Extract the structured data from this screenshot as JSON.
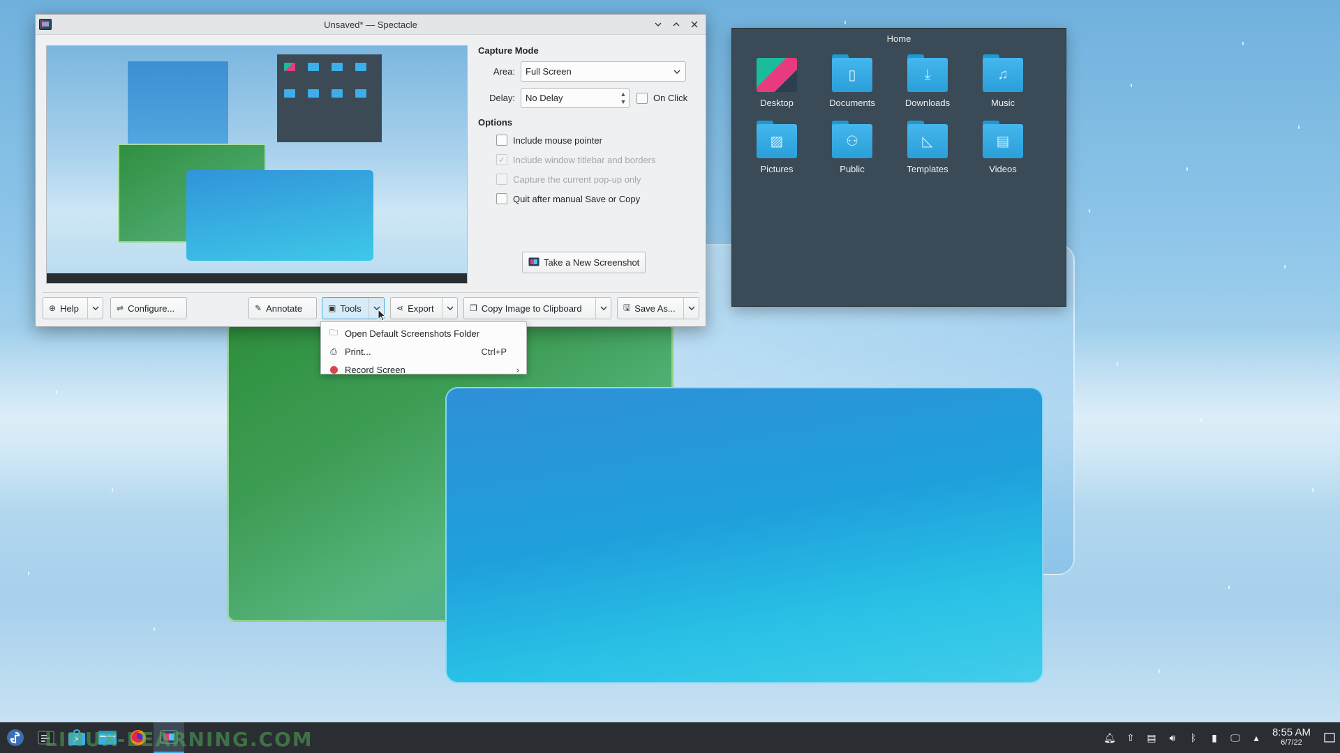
{
  "window": {
    "title": "Unsaved* — Spectacle"
  },
  "capture_mode": {
    "heading": "Capture Mode",
    "area_label": "Area:",
    "area_value": "Full Screen",
    "delay_label": "Delay:",
    "delay_value": "No Delay",
    "on_click_label": "On Click"
  },
  "options": {
    "heading": "Options",
    "items": [
      {
        "label": "Include mouse pointer",
        "checked": false,
        "enabled": true
      },
      {
        "label": "Include window titlebar and borders",
        "checked": true,
        "enabled": false
      },
      {
        "label": "Capture the current pop-up only",
        "checked": false,
        "enabled": false
      },
      {
        "label": "Quit after manual Save or Copy",
        "checked": false,
        "enabled": true
      }
    ]
  },
  "take_screenshot_label": "Take a New Screenshot",
  "buttons": {
    "help": "Help",
    "configure": "Configure...",
    "annotate": "Annotate",
    "tools": "Tools",
    "export": "Export",
    "copy": "Copy Image to Clipboard",
    "save_as": "Save As..."
  },
  "tools_menu": {
    "items": [
      {
        "label": "Open Default Screenshots Folder",
        "shortcut": ""
      },
      {
        "label": "Print...",
        "shortcut": "Ctrl+P"
      },
      {
        "label": "Record Screen",
        "shortcut": ""
      }
    ]
  },
  "home_popup": {
    "title": "Home",
    "folders": [
      {
        "name": "Desktop",
        "icon": "desktop-icon"
      },
      {
        "name": "Documents",
        "icon": "folder-documents-icon"
      },
      {
        "name": "Downloads",
        "icon": "folder-downloads-icon"
      },
      {
        "name": "Music",
        "icon": "folder-music-icon"
      },
      {
        "name": "Pictures",
        "icon": "folder-pictures-icon"
      },
      {
        "name": "Public",
        "icon": "folder-public-icon"
      },
      {
        "name": "Templates",
        "icon": "folder-templates-icon"
      },
      {
        "name": "Videos",
        "icon": "folder-videos-icon"
      }
    ]
  },
  "taskbar": {
    "watermark": "LINUX-LEARNING.COM",
    "clock_time": "8:55 AM",
    "clock_date": "6/7/22"
  },
  "colors": {
    "accent": "#3daee9",
    "panel": "#2a2e32",
    "record": "#da4453"
  }
}
